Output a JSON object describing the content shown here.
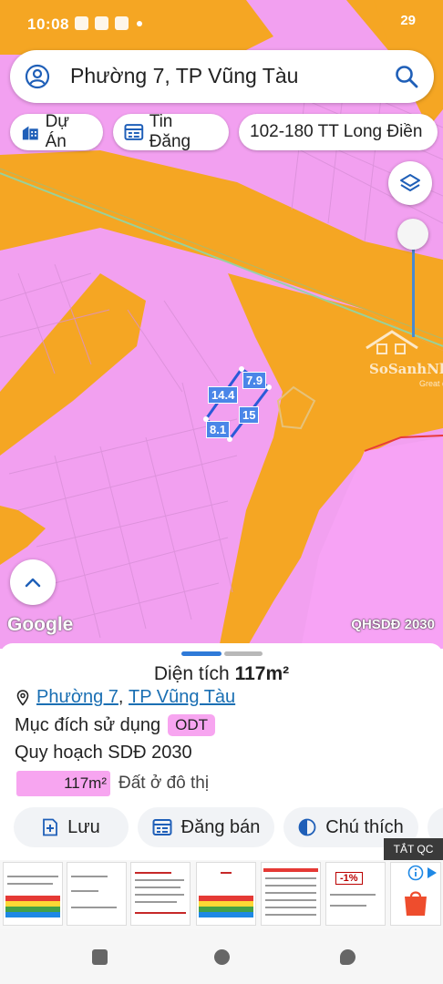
{
  "status_bar": {
    "time": "10:08",
    "right_text": "29"
  },
  "search": {
    "query": "Phường 7, TP Vũng Tàu"
  },
  "chips": [
    {
      "label": "Dự Án",
      "icon": "building-icon"
    },
    {
      "label": "Tin Đăng",
      "icon": "listing-icon"
    },
    {
      "label": "102-180 TT Long Điền",
      "icon": ""
    }
  ],
  "map": {
    "watermark_title": "SoSanhNha",
    "watermark_sub": "Great deal",
    "parcel_dimensions": [
      "7.9",
      "14.4",
      "15",
      "8.1"
    ],
    "provider": "Google",
    "plan_layer": "QHSDĐ 2030",
    "colors": {
      "residential": "#f2a0f0",
      "road": "#f5a623",
      "parcel_outline": "#4a86e8"
    }
  },
  "sheet": {
    "area_label": "Diện tích",
    "area_value": "117m²",
    "location_ward": "Phường 7",
    "location_sep": ",",
    "location_city": "TP Vũng Tàu",
    "purpose_label": "Mục đích sử dụng",
    "purpose_code": "ODT",
    "plan_title": "Quy hoạch SDĐ 2030",
    "legend_area": "117m²",
    "legend_text": "Đất ở đô thị",
    "actions": [
      {
        "label": "Lưu",
        "icon": "save-plus-icon"
      },
      {
        "label": "Đăng bán",
        "icon": "listing-icon"
      },
      {
        "label": "Chú thích",
        "icon": "contrast-icon"
      }
    ]
  },
  "ad": {
    "label": "TẮT QC",
    "thumb_texts": [
      "-1%"
    ]
  }
}
